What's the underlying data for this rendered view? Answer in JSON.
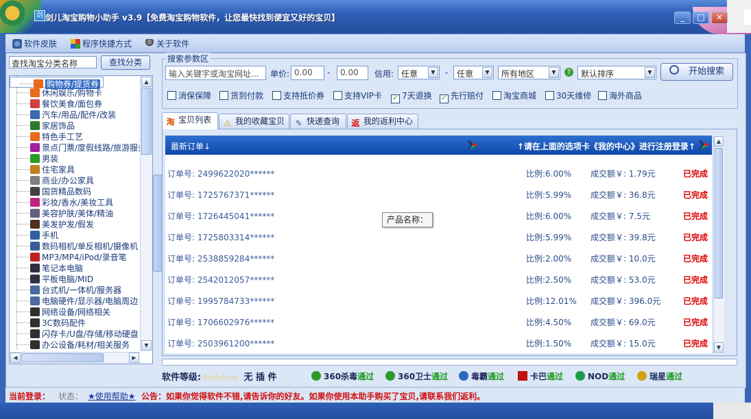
{
  "window": {
    "title": "剑儿淘宝购物小助手 v3.9【免费淘宝购物软件，让您最快找到便宜又好的宝贝】",
    "icon_glyph": "剑",
    "buttons": [
      "_",
      "□",
      "×"
    ]
  },
  "menu": [
    {
      "label": "软件皮肤",
      "icon": "skin-icon"
    },
    {
      "label": "程序快捷方式",
      "icon": "shortcut-icon"
    },
    {
      "label": "关于软件",
      "icon": "about-icon"
    }
  ],
  "left": {
    "search_value": "查找淘宝分类名称",
    "search_button": "查找分类",
    "categories": [
      {
        "label": "购物券/提货券",
        "icon_color": "#e86a1a",
        "selected": true
      },
      {
        "label": "休闲娱乐/购物卡",
        "icon_color": "#e86a1a"
      },
      {
        "label": "餐饮美食/面包券",
        "icon_color": "#d04040"
      },
      {
        "label": "汽车/用品/配件/改装",
        "icon_color": "#3a6ab0"
      },
      {
        "label": "家居饰品",
        "icon_color": "#2a7a2a"
      },
      {
        "label": "特色手工艺",
        "icon_color": "#e86a1a"
      },
      {
        "label": "景点门票/度假线路/旅游服务",
        "icon_color": "#a020a0"
      },
      {
        "label": "男装",
        "icon_color": "#2a9a2a"
      },
      {
        "label": "住宅家具",
        "icon_color": "#c08020"
      },
      {
        "label": "商业/办公家具",
        "icon_color": "#808080"
      },
      {
        "label": "国货精品数码",
        "icon_color": "#404040"
      },
      {
        "label": "彩妆/香水/美妆工具",
        "icon_color": "#c02080"
      },
      {
        "label": "美容护肤/美体/精油",
        "icon_color": "#606080"
      },
      {
        "label": "美发护发/假发",
        "icon_color": "#503020"
      },
      {
        "label": "手机",
        "icon_color": "#3060a0"
      },
      {
        "label": "数码相机/单反相机/摄像机",
        "icon_color": "#3a5a9a"
      },
      {
        "label": "MP3/MP4/iPod/录音笔",
        "icon_color": "#c02020"
      },
      {
        "label": "笔记本电脑",
        "icon_color": "#303040"
      },
      {
        "label": "平板电脑/MID",
        "icon_color": "#303040"
      },
      {
        "label": "台式机/一体机/服务器",
        "icon_color": "#4a6aa0"
      },
      {
        "label": "电脑硬件/显示器/电脑周边",
        "icon_color": "#4a6aa0"
      },
      {
        "label": "网络设备/网络相关",
        "icon_color": "#303030"
      },
      {
        "label": "3C数码配件",
        "icon_color": "#303030"
      },
      {
        "label": "闪存卡/U盘/存储/移动硬盘",
        "icon_color": "#303030"
      },
      {
        "label": "办公设备/耗材/相关服务",
        "icon_color": "#303030"
      }
    ]
  },
  "params": {
    "legend": "搜索参数区",
    "keyword_placeholder": "输入关键字或淘宝网址...",
    "price_label": "单价:",
    "price_min": "0.00",
    "dash": "-",
    "price_max": "0.00",
    "credit_label": "信用:",
    "credit_from": "任意",
    "credit_to": "任意",
    "region": "所有地区",
    "sort": "默认排序",
    "start_button": "开始搜索",
    "checkboxes": [
      {
        "label": "消保保障",
        "checked": false
      },
      {
        "label": "货到付款",
        "checked": false
      },
      {
        "label": "支持抵价券",
        "checked": false
      },
      {
        "label": "支持VIP卡",
        "checked": false
      },
      {
        "label": "7天退换",
        "checked": true
      },
      {
        "label": "先行赔付",
        "checked": true
      },
      {
        "label": "淘宝商城",
        "checked": false
      },
      {
        "label": "30天维修",
        "checked": false
      },
      {
        "label": "海外商品",
        "checked": false
      }
    ]
  },
  "tabs": [
    {
      "label": "宝贝列表",
      "icon": "淘",
      "active": true
    },
    {
      "label": "我的收藏宝贝",
      "icon": "⚠"
    },
    {
      "label": "快递查询",
      "icon": "✎"
    },
    {
      "label": "我的返利中心",
      "icon": "返"
    }
  ],
  "orders": {
    "header_left": "最新订单↓",
    "header_right": "↑请在上面的选项卡《我的中心》进行注册登录↑",
    "rows": [
      {
        "order": "订单号: 2499622020******",
        "ratio": "比例:6.00%",
        "amount": "成交额￥: 1.79元",
        "status": "已完成"
      },
      {
        "order": "订单号: 1725767371******",
        "ratio": "比例:5.99%",
        "amount": "成交额￥: 36.8元",
        "status": "已完成"
      },
      {
        "order": "订单号: 1726445041******",
        "ratio": "比例:6.00%",
        "amount": "成交额￥: 7.5元",
        "status": "已完成"
      },
      {
        "order": "订单号: 1725803314******",
        "ratio": "比例:5.99%",
        "amount": "成交额￥: 39.8元",
        "status": "已完成"
      },
      {
        "order": "订单号: 2538859284******",
        "ratio": "比例:2.00%",
        "amount": "成交额￥: 10.0元",
        "status": "已完成"
      },
      {
        "order": "订单号: 2542012057******",
        "ratio": "比例:2.50%",
        "amount": "成交额￥: 53.0元",
        "status": "已完成"
      },
      {
        "order": "订单号: 1995784733******",
        "ratio": "比例:12.01%",
        "amount": "成交额￥: 396.0元",
        "status": "已完成"
      },
      {
        "order": "订单号: 1706602976******",
        "ratio": "比例:4.50%",
        "amount": "成交额￥: 69.0元",
        "status": "已完成"
      },
      {
        "order": "订单号: 2503961200******",
        "ratio": "比例:1.50%",
        "amount": "成交额￥: 15.0元",
        "status": "已完成"
      }
    ],
    "tooltip": "产品名称："
  },
  "grade": {
    "label": "软件等级:",
    "stars": "☆☆☆☆☆☆",
    "plugin": "无 插 件",
    "av": [
      {
        "name": "360杀毒",
        "pass": "通过",
        "color": "#2a9a2a"
      },
      {
        "name": "360卫士",
        "pass": "通过",
        "color": "#2a9a2a"
      },
      {
        "name": "毒霸",
        "pass": "通过",
        "color": "#2a6ac0"
      },
      {
        "name": "卡巴",
        "pass": "通过",
        "color": "#c01010"
      },
      {
        "name": "NOD",
        "pass": "通过",
        "color": "#1a9a4a"
      },
      {
        "name": "瑞星",
        "pass": "通过",
        "color": "#d0a010"
      }
    ]
  },
  "status": {
    "login": "当前登录：",
    "state": "状态：",
    "help": "★使用帮助★",
    "notice": "公告：如果你觉得软件不错,请告诉你的好友。如果你使用本助手购买了宝贝,请联系我们返利。"
  }
}
